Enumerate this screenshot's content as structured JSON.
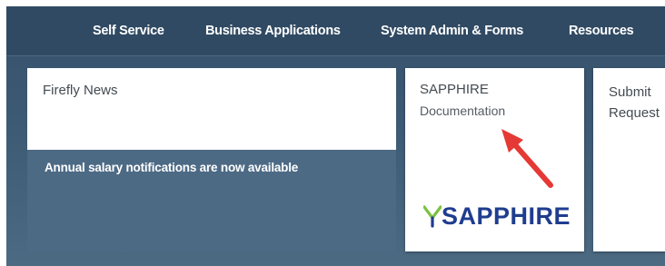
{
  "nav": {
    "items": [
      {
        "label": "Self Service"
      },
      {
        "label": "Business Applications"
      },
      {
        "label": "System Admin & Forms"
      },
      {
        "label": "Resources"
      }
    ]
  },
  "news": {
    "title": "Firefly News",
    "items": [
      "Annual salary notifications are now available"
    ]
  },
  "sapphire": {
    "title": "SAPPHIRE",
    "subtitle": "Documentation",
    "logo_text": "SAPPHIRE"
  },
  "submit": {
    "line1": "Submit",
    "line2": "Request"
  },
  "colors": {
    "nav_bg": "#304a63",
    "panel_bg": "#4d6a85",
    "logo_blue": "#1f3d8f",
    "logo_green": "#7cc242",
    "arrow_red": "#e53935"
  }
}
